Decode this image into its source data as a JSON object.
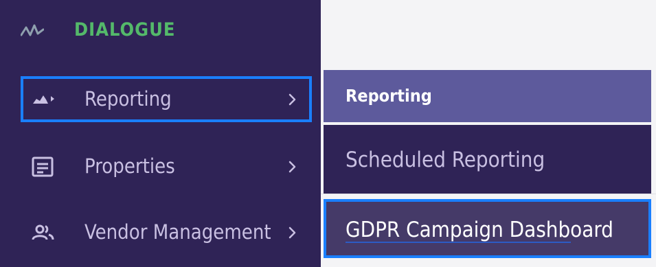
{
  "brand": {
    "name": "DIALOGUE",
    "icon": "pulse-icon",
    "color": "#54b96a"
  },
  "sidebar": {
    "items": [
      {
        "label": "Reporting",
        "icon": "area-chart-icon",
        "active": true
      },
      {
        "label": "Properties",
        "icon": "document-icon",
        "active": false
      },
      {
        "label": "Vendor Management",
        "icon": "people-icon",
        "active": false
      }
    ]
  },
  "flyout": {
    "header": "Reporting",
    "items": [
      {
        "label": "Scheduled Reporting",
        "active": false
      },
      {
        "label": "GDPR Campaign Dashboard",
        "active": true
      }
    ]
  },
  "colors": {
    "sidebar_bg": "#2f2356",
    "flyout_header_bg": "#5d5a9c",
    "focus_outline": "#1a7fff",
    "brand": "#54b96a"
  }
}
